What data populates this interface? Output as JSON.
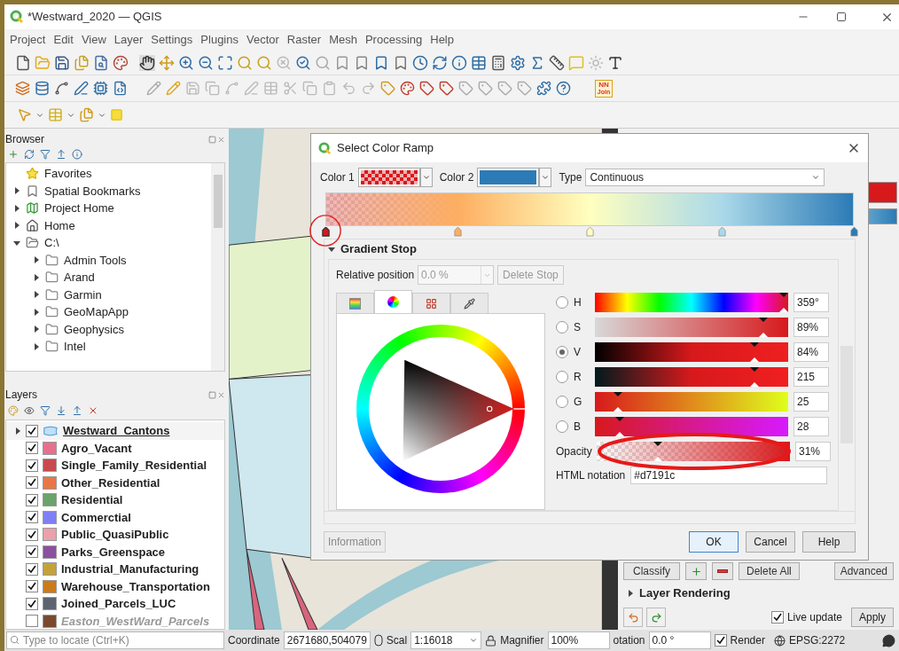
{
  "window": {
    "title": "*Westward_2020 — QGIS"
  },
  "menu": [
    {
      "label": "Project"
    },
    {
      "label": "Edit"
    },
    {
      "label": "View"
    },
    {
      "label": "Layer"
    },
    {
      "label": "Settings"
    },
    {
      "label": "Plugins"
    },
    {
      "label": "Vector"
    },
    {
      "label": "Raster"
    },
    {
      "label": "Mesh"
    },
    {
      "label": "Processing"
    },
    {
      "label": "Help"
    }
  ],
  "plugin_badge": {
    "top": "NN",
    "bottom": "Join"
  },
  "browser": {
    "title": "Browser",
    "items": [
      {
        "label": "Favorites",
        "kind": "favorites"
      },
      {
        "label": "Spatial Bookmarks",
        "kind": "bookmarks",
        "expanded": false
      },
      {
        "label": "Project Home",
        "kind": "project",
        "expanded": false
      },
      {
        "label": "Home",
        "kind": "home",
        "expanded": false
      },
      {
        "label": "C:\\",
        "kind": "drive",
        "expanded": true,
        "children": [
          {
            "label": "Admin Tools",
            "kind": "folder",
            "expanded": false
          },
          {
            "label": "Arand",
            "kind": "folder",
            "expanded": false
          },
          {
            "label": "Garmin",
            "kind": "folder",
            "expanded": false
          },
          {
            "label": "GeoMapApp",
            "kind": "folder",
            "expanded": false
          },
          {
            "label": "Geophysics",
            "kind": "folder",
            "expanded": false
          },
          {
            "label": "Intel",
            "kind": "folder",
            "expanded": false
          }
        ]
      }
    ]
  },
  "layers": {
    "title": "Layers",
    "items": [
      {
        "name": "Westward_Cantons",
        "kind": "group",
        "checked": true,
        "selected": true
      },
      {
        "name": "Agro_Vacant",
        "kind": "symbol",
        "color": "#e8708f",
        "checked": true,
        "selected": false
      },
      {
        "name": "Single_Family_Residential",
        "kind": "symbol",
        "color": "#c84a4e",
        "checked": true,
        "selected": false
      },
      {
        "name": "Other_Residential",
        "kind": "symbol",
        "color": "#e87748",
        "checked": true,
        "selected": false
      },
      {
        "name": "Residential",
        "kind": "symbol",
        "color": "#6aa36b",
        "checked": true,
        "selected": false
      },
      {
        "name": "Commerctial",
        "kind": "symbol",
        "color": "#7f7ff5",
        "checked": true,
        "selected": false
      },
      {
        "name": "Public_QuasiPublic",
        "kind": "symbol",
        "color": "#eaa1aa",
        "checked": true,
        "selected": false
      },
      {
        "name": "Parks_Greenspace",
        "kind": "symbol",
        "color": "#8b50a0",
        "checked": true,
        "selected": false
      },
      {
        "name": "Industrial_Manufacturing",
        "kind": "symbol",
        "color": "#c4a23a",
        "checked": true,
        "selected": false
      },
      {
        "name": "Warehouse_Transportation",
        "kind": "symbol",
        "color": "#cc7a1a",
        "checked": true,
        "selected": false
      },
      {
        "name": "Joined_Parcels_LUC",
        "kind": "symbol",
        "color": "#5d6470",
        "checked": true,
        "selected": false
      },
      {
        "name": "Easton_WestWard_Parcels",
        "kind": "symbol",
        "color": "#7a4a2e",
        "checked": false,
        "selected": false
      }
    ]
  },
  "dialog": {
    "title": "Select Color Ramp",
    "color1": {
      "label": "Color 1",
      "color": "#d7191c"
    },
    "color2": {
      "label": "Color 2",
      "color": "#2c7bb6"
    },
    "type": {
      "label": "Type",
      "value": "Continuous"
    },
    "stops": [
      {
        "level": 0,
        "color": "#d7191c",
        "selected": true
      },
      {
        "level": 0.25,
        "color": "#fdae61",
        "selected": false
      },
      {
        "level": 0.5,
        "color": "#ffffbf",
        "selected": false
      },
      {
        "level": 0.75,
        "color": "#abd9e9",
        "selected": false
      },
      {
        "level": 1,
        "color": "#2c7bb6",
        "selected": false
      }
    ],
    "section": {
      "title": "Gradient Stop",
      "expanded": true
    },
    "relative_position": {
      "label": "Relative position",
      "value": "0.0 %"
    },
    "delete_stop": {
      "label": "Delete Stop",
      "disabled": true
    },
    "picker_tabs": [
      {
        "kind": "ramp",
        "selected": false
      },
      {
        "kind": "wheel",
        "selected": true
      },
      {
        "kind": "swatches",
        "selected": false
      },
      {
        "kind": "dropper",
        "selected": false
      }
    ],
    "channels": [
      {
        "label": "H",
        "kind": "hue",
        "selected": false,
        "level": 1,
        "reading": "359°"
      },
      {
        "label": "S",
        "kind": "sat",
        "selected": false,
        "level": 0.89,
        "reading": "89%"
      },
      {
        "label": "V",
        "kind": "val",
        "selected": true,
        "level": 0.84,
        "reading": "84%"
      },
      {
        "label": "R",
        "kind": "red",
        "selected": false,
        "level": 0.84,
        "reading": "215"
      },
      {
        "label": "G",
        "kind": "green",
        "selected": false,
        "level": 0.1,
        "reading": "25"
      },
      {
        "label": "B",
        "kind": "blue",
        "selected": false,
        "level": 0.11,
        "reading": "28"
      }
    ],
    "opacity": {
      "label": "Opacity",
      "level": 0.31,
      "reading": "31%"
    },
    "html": {
      "label": "HTML notation",
      "value": "#d7191c"
    },
    "buttons": {
      "information": "Information",
      "ok": "OK",
      "cancel": "Cancel",
      "help": "Help"
    }
  },
  "style_panel": {
    "classify": "Classify",
    "delete_all": "Delete All",
    "advanced": "Advanced",
    "rendering": {
      "title": "Layer Rendering",
      "expanded": false
    },
    "live_update": {
      "label": "Live update",
      "checked": true
    },
    "apply": "Apply"
  },
  "status_bar": {
    "locate_placeholder": "Type to locate (Ctrl+K)",
    "coordinate_label": "Coordinate",
    "coordinate": "2671680,504079",
    "scale_label": "Scal",
    "scale": "1:16018",
    "magnifier_label": "Magnifier",
    "magnifier": "100%",
    "rotation_label": "otation",
    "rotation": "0.0 °",
    "render": {
      "label": "Render",
      "checked": true
    },
    "crs": "EPSG:2272"
  }
}
